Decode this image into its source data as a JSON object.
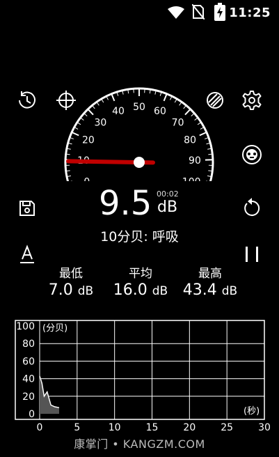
{
  "status_bar": {
    "time": "11:25"
  },
  "meter": {
    "value": "9.5",
    "unit": "dB",
    "elapsed": "00:02",
    "description": "10分贝: 呼吸",
    "gauge_ticks": [
      "0",
      "10",
      "20",
      "30",
      "40",
      "50",
      "60",
      "70",
      "80",
      "90",
      "100"
    ],
    "needle_value_db": 9.5
  },
  "stats": [
    {
      "label": "最低",
      "value": "7.0",
      "unit": "dB"
    },
    {
      "label": "平均",
      "value": "16.0",
      "unit": "dB"
    },
    {
      "label": "最高",
      "value": "43.4",
      "unit": "dB"
    }
  ],
  "chart_data": {
    "type": "line",
    "ylabel": "(分贝)",
    "xlabel": "(秒)",
    "y_ticks": [
      "100",
      "80",
      "60",
      "40",
      "20",
      "0"
    ],
    "x_ticks": [
      "0",
      "5",
      "10",
      "15",
      "20",
      "25",
      "30"
    ],
    "xlim": [
      0,
      30
    ],
    "ylim": [
      0,
      100
    ],
    "grid": true,
    "series": [
      {
        "x": [
          0,
          0.3,
          0.6,
          1.0,
          1.5,
          2.0,
          2.6
        ],
        "y": [
          43,
          35,
          20,
          25,
          10,
          8,
          7
        ]
      }
    ]
  },
  "footer": {
    "watermark": "康掌门 • KANGZM.COM"
  }
}
